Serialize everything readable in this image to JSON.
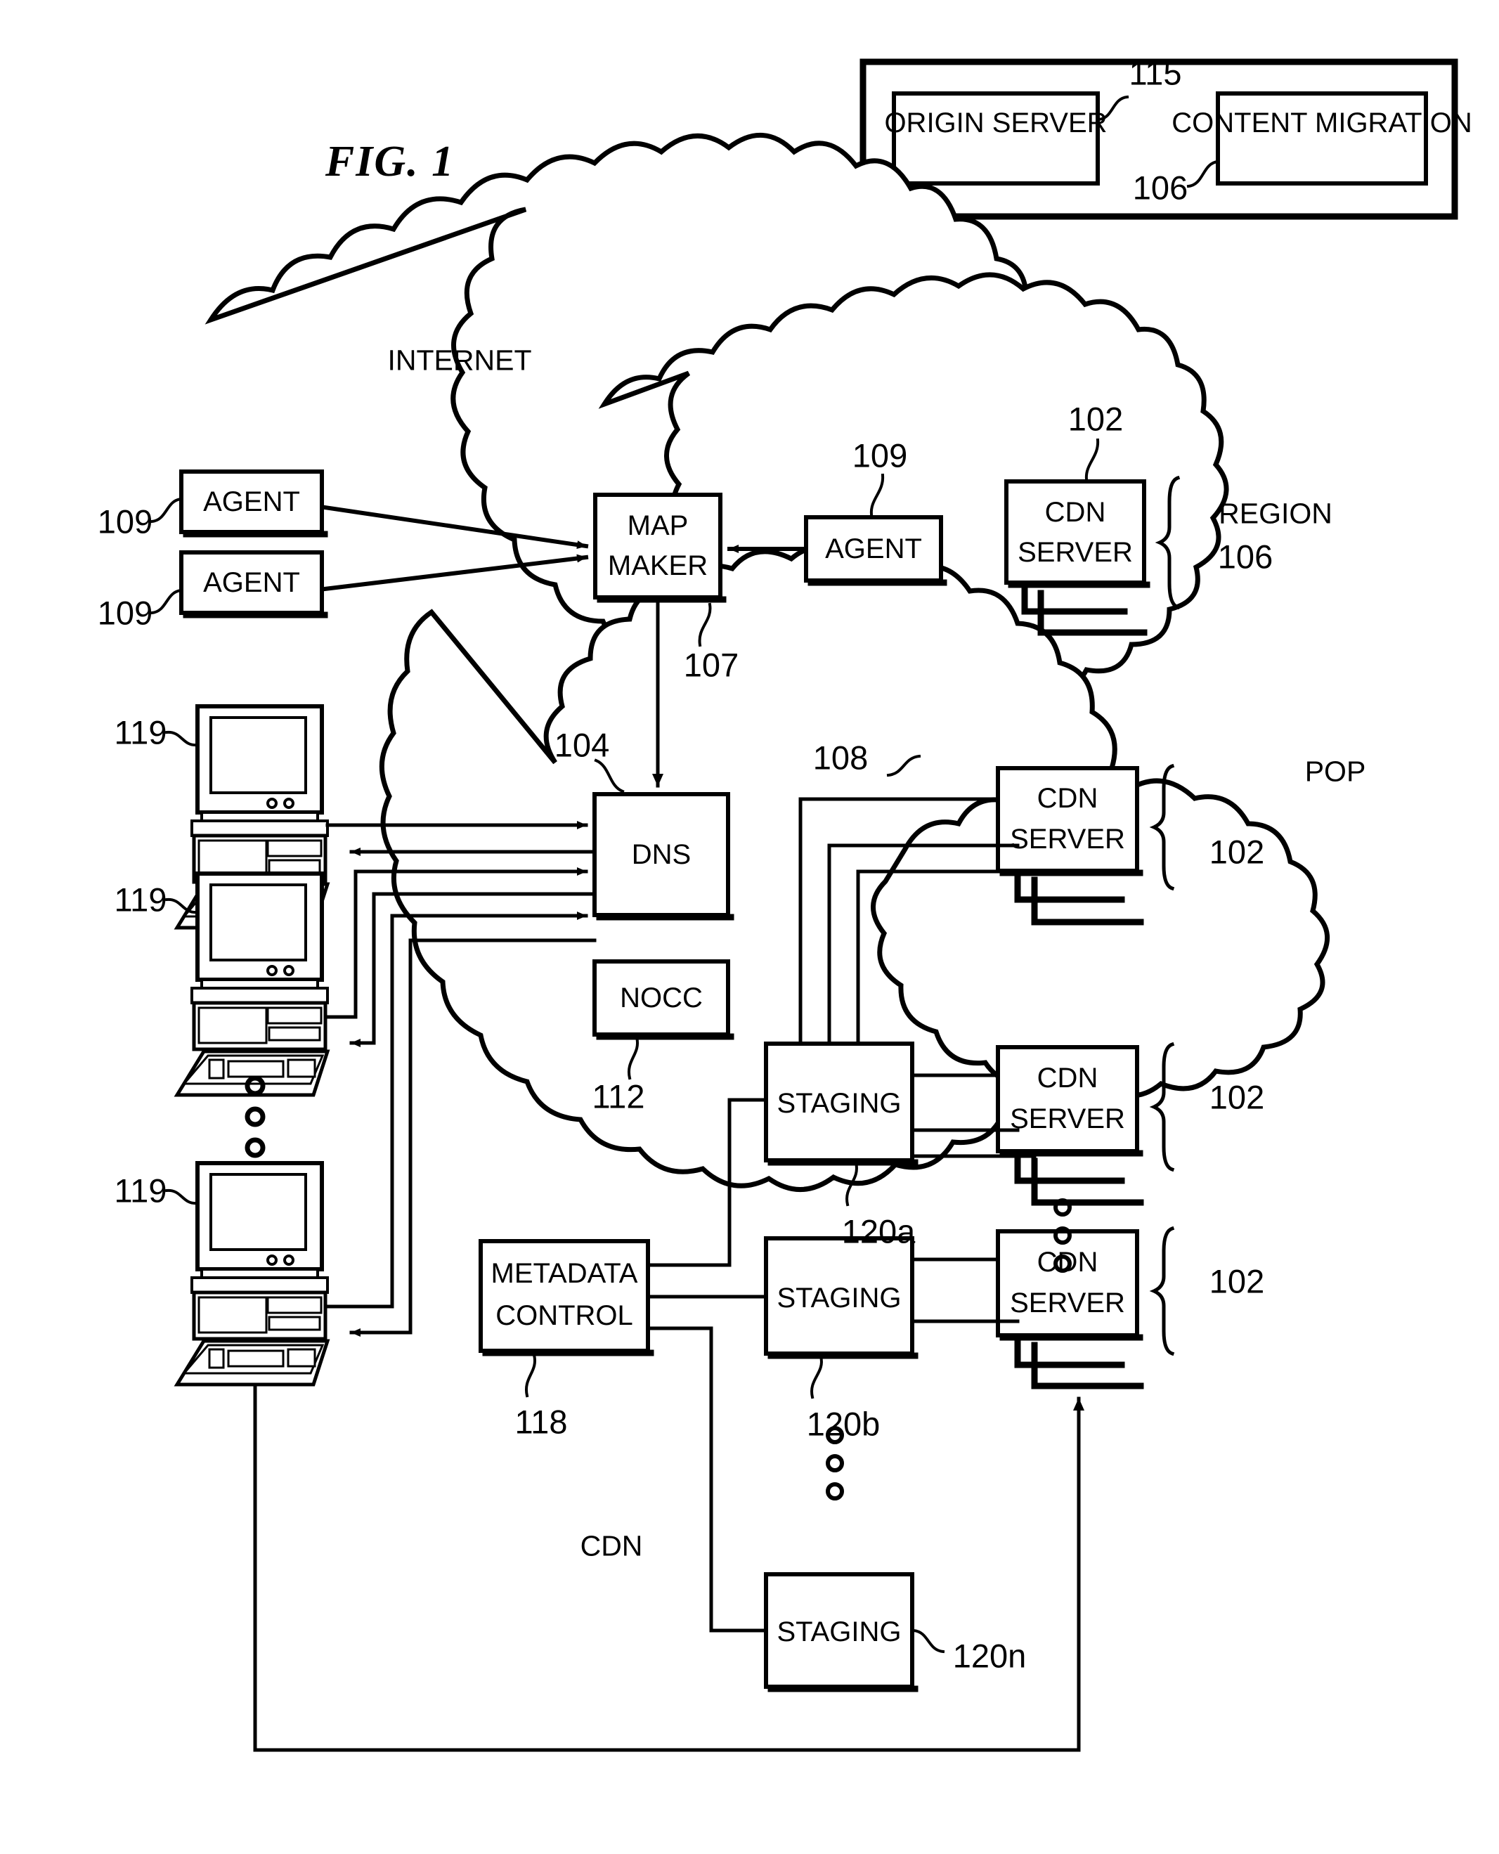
{
  "figure": {
    "title": "FIG. 1",
    "domain_note": "patent diagram"
  },
  "legend_box": {
    "items": [
      {
        "label": "ORIGIN SERVER",
        "ref": "115"
      },
      {
        "label": "CONTENT MIGRATION",
        "ref": "106"
      }
    ]
  },
  "clouds": [
    {
      "name": "internet",
      "label": "INTERNET"
    },
    {
      "name": "region",
      "label": ""
    },
    {
      "name": "pop",
      "label": "POP"
    },
    {
      "name": "cdn",
      "label": "CDN"
    }
  ],
  "internet": {
    "label": "INTERNET",
    "agents": [
      {
        "label": "AGENT",
        "ref": "109"
      },
      {
        "label": "AGENT",
        "ref": "109"
      },
      {
        "label": "AGENT",
        "ref": "109"
      }
    ],
    "map_maker": {
      "label_line1": "MAP",
      "label_line2": "MAKER",
      "ref": "107"
    },
    "region": {
      "cdn_server": {
        "label_line1": "CDN",
        "label_line2": "SERVER",
        "ref": "102"
      },
      "brace_label_line1": "REGION",
      "brace_label_line2": "106"
    }
  },
  "cdn": {
    "label": "CDN",
    "dns": {
      "label": "DNS",
      "ref": "104"
    },
    "nocc": {
      "label": "NOCC",
      "ref": "112"
    },
    "metadata_control": {
      "label_line1": "METADATA",
      "label_line2": "CONTROL",
      "ref": "118"
    },
    "staging": [
      {
        "label": "STAGING",
        "ref": "120a"
      },
      {
        "label": "STAGING",
        "ref": "120b"
      },
      {
        "label": "STAGING",
        "ref": "120n"
      }
    ],
    "pop": {
      "label": "POP",
      "ref": "108",
      "cdn_server": {
        "label_line1": "CDN",
        "label_line2": "SERVER",
        "ref": "102"
      }
    },
    "server_groups": [
      {
        "label_line1": "CDN",
        "label_line2": "SERVER",
        "ref": "102"
      },
      {
        "label_line1": "CDN",
        "label_line2": "SERVER",
        "ref": "102"
      }
    ]
  },
  "clients": [
    {
      "name": "client-top",
      "ref": "119"
    },
    {
      "name": "client-middle",
      "ref": "119"
    },
    {
      "name": "client-bottom",
      "ref": "119"
    }
  ],
  "colors": {
    "ink": "#000000",
    "paper": "#ffffff"
  }
}
